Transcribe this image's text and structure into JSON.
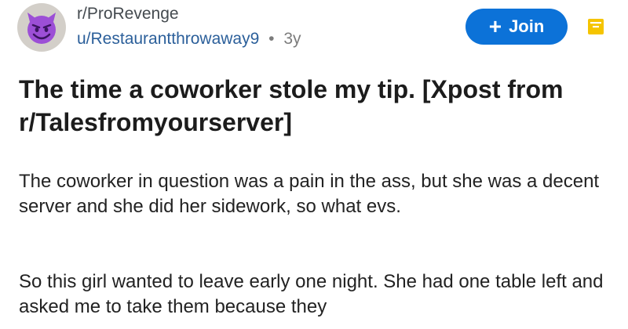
{
  "post": {
    "subreddit": "r/ProRevenge",
    "author": "u/Restaurantthrowaway9",
    "separator": "•",
    "age": "3y",
    "join_label": "Join",
    "title": "The time a coworker stole my tip. [Xpost from r/Talesfromyourserver]",
    "paragraphs": [
      "The coworker in question was a pain in the ass, but she was a decent server and she did her sidework, so what evs.",
      "So this girl wanted to leave early one night. She had one table left and asked me to take them because they"
    ]
  },
  "icons": {
    "avatar": "devil-emoji-icon",
    "join": "plus-icon",
    "save": "save-icon"
  },
  "colors": {
    "join_button": "#0c72d8",
    "author_link": "#2b5f9a",
    "avatar_devil": "#9c4fd6",
    "save_icon": "#f5c400"
  }
}
